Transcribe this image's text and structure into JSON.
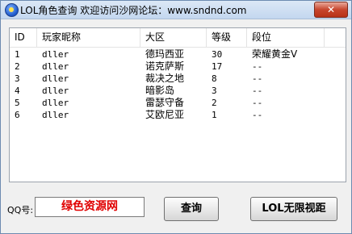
{
  "window": {
    "title": "LOL角色查询  欢迎访问沙网论坛：www.sndnd.com",
    "close_label": "✕"
  },
  "table": {
    "columns": [
      "ID",
      "玩家昵称",
      "大区",
      "等级",
      "段位"
    ],
    "rows": [
      {
        "id": "1",
        "nickname": "dller",
        "region": "德玛西亚",
        "level": "30",
        "rank": "荣耀黄金V"
      },
      {
        "id": "2",
        "nickname": "dller",
        "region": "诺克萨斯",
        "level": "17",
        "rank": "--"
      },
      {
        "id": "3",
        "nickname": "dller",
        "region": "裁决之地",
        "level": "8",
        "rank": "--"
      },
      {
        "id": "4",
        "nickname": "dller",
        "region": "暗影岛",
        "level": "3",
        "rank": "--"
      },
      {
        "id": "5",
        "nickname": "dller",
        "region": "雷瑟守备",
        "level": "2",
        "rank": "--"
      },
      {
        "id": "6",
        "nickname": "dller",
        "region": "艾欧尼亚",
        "level": "1",
        "rank": "--"
      }
    ]
  },
  "form": {
    "qq_label": "QQ号:",
    "qq_value": "绿色资源网",
    "query_button": "查询",
    "lol_button": "LOL无限视距"
  }
}
